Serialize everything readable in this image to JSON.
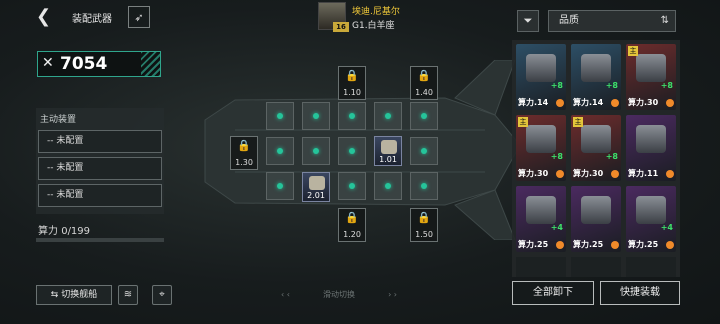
{
  "header": {
    "title": "装配武器",
    "pilot": {
      "name": "埃迪.尼基尔",
      "ship": "G1.白羊座",
      "level": "16"
    }
  },
  "power": {
    "value": "7054"
  },
  "active_equipment": {
    "label": "主动装置",
    "slots": [
      "-- 未配置",
      "-- 未配置",
      "-- 未配置"
    ]
  },
  "compute": {
    "label": "算力",
    "used": "0",
    "max": "/199"
  },
  "ship_slots": {
    "locks": [
      "1.10",
      "1.40",
      "1.30",
      "1.20",
      "1.50"
    ],
    "equipped": [
      "1.01",
      "2.01"
    ]
  },
  "sort": {
    "label": "品质"
  },
  "inventory": {
    "items": [
      {
        "power": "算力.14",
        "level": "+8",
        "color": "#2d4f66",
        "tag": ""
      },
      {
        "power": "算力.14",
        "level": "+8",
        "color": "#2d4f66",
        "tag": ""
      },
      {
        "power": "算力.30",
        "level": "+8",
        "color": "#6d2c2c",
        "tag": "主"
      },
      {
        "power": "算力.30",
        "level": "+8",
        "color": "#6d2c2c",
        "tag": "主"
      },
      {
        "power": "算力.30",
        "level": "+8",
        "color": "#6d2c2c",
        "tag": "主"
      },
      {
        "power": "算力.11",
        "level": "",
        "color": "#4b2a60",
        "tag": ""
      },
      {
        "power": "算力.25",
        "level": "+4",
        "color": "#4b2a60",
        "tag": ""
      },
      {
        "power": "算力.25",
        "level": "",
        "color": "#4b2a60",
        "tag": ""
      },
      {
        "power": "算力.25",
        "level": "+4",
        "color": "#4b2a60",
        "tag": ""
      }
    ]
  },
  "buttons": {
    "switch_ship": "⇆ 切换舰船",
    "swipe_hint": "滑动切换",
    "unequip_all": "全部卸下",
    "quick_equip": "快捷装载"
  }
}
